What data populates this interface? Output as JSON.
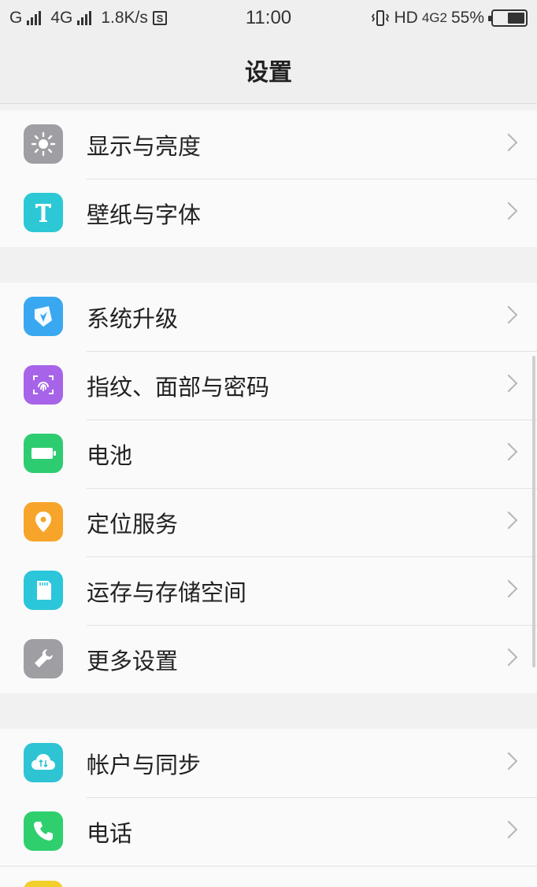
{
  "status_bar": {
    "left_1": "G",
    "left_2": "4G",
    "speed": "1.8K/s",
    "s_badge": "S",
    "time": "11:00",
    "hd": "HD",
    "net": "4G2",
    "battery_text": "55%",
    "battery_level": 0.55
  },
  "header": {
    "title": "设置"
  },
  "groups": [
    {
      "items": [
        {
          "label": "显示与亮度",
          "icon": "brightness-icon",
          "color": "#9e9ea3"
        },
        {
          "label": "壁纸与字体",
          "icon": "text-icon",
          "color": "#2cc8d6"
        }
      ]
    },
    {
      "items": [
        {
          "label": "系统升级",
          "icon": "system-update-icon",
          "color": "#3aa8f0"
        },
        {
          "label": "指纹、面部与密码",
          "icon": "fingerprint-icon",
          "color": "#a764e8"
        },
        {
          "label": "电池",
          "icon": "battery-icon",
          "color": "#2ecc71"
        },
        {
          "label": "定位服务",
          "icon": "location-icon",
          "color": "#f7a52a"
        },
        {
          "label": "运存与存储空间",
          "icon": "storage-icon",
          "color": "#2bc6d9"
        },
        {
          "label": "更多设置",
          "icon": "wrench-icon",
          "color": "#9e9ea3"
        }
      ]
    },
    {
      "items": [
        {
          "label": "帐户与同步",
          "icon": "cloud-sync-icon",
          "color": "#2ec4d4"
        },
        {
          "label": "电话",
          "icon": "phone-icon",
          "color": "#2fcf6e"
        }
      ]
    }
  ]
}
